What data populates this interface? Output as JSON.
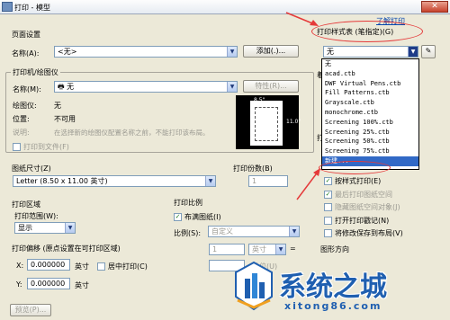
{
  "window": {
    "title": "打印 - 模型",
    "close": "✕"
  },
  "page_setup": {
    "group_label": "页面设置",
    "name_label": "名称(A):",
    "name_value": "<无>",
    "add_button": "添加(.)..."
  },
  "printer": {
    "group_label": "打印机/绘图仪",
    "name_label": "名称(M):",
    "name_value": "无",
    "properties_button": "特性(R)...",
    "plotter_label": "绘图仪:",
    "plotter_value": "无",
    "location_label": "位置:",
    "location_value": "不可用",
    "description_label": "说明:",
    "description_value": "在选择新的绘图仪配置名称之前，不能打印该布局。",
    "print_to_file": "打印到文件(F)",
    "preview_width": "8.5\"",
    "preview_height": "11.0\""
  },
  "paper_size": {
    "label": "图纸尺寸(Z)",
    "value": "Letter (8.50 x 11.00 英寸)"
  },
  "copies": {
    "label": "打印份数(B)",
    "value": "1"
  },
  "plot_area": {
    "group_label": "打印区域",
    "range_label": "打印范围(W):",
    "range_value": "显示"
  },
  "plot_scale": {
    "group_label": "打印比例",
    "fit_paper": "布满图纸(I)",
    "scale_label": "比例(S):",
    "scale_value": "自定义",
    "value1": "1",
    "unit": "英寸",
    "equals": "=",
    "value2": "",
    "units_label": "单位(U)"
  },
  "plot_offset": {
    "group_label": "打印偏移 (原点设置在可打印区域)",
    "x_label": "X:",
    "x_value": "0.000000",
    "x_unit": "英寸",
    "y_label": "Y:",
    "y_value": "0.000000",
    "y_unit": "英寸",
    "center": "居中打印(C)"
  },
  "preview_button": "预览(P)...",
  "help_link": "了解打印",
  "style_table": {
    "label": "打印样式表 (笔指定)(G)",
    "value": "无",
    "items": [
      "无",
      "acad.ctb",
      "DWF Virtual Pens.ctb",
      "Fill Patterns.ctb",
      "Grayscale.ctb",
      "monochrome.ctb",
      "Screening 100%.ctb",
      "Screening 25%.ctb",
      "Screening 50%.ctb",
      "Screening 75%.ctb",
      "新建..."
    ],
    "selected_index": 10
  },
  "right_options": {
    "partial_labels": [
      "着",
      "打"
    ],
    "items": [
      {
        "label": "按样式打印(E)",
        "checked": true,
        "disabled": false
      },
      {
        "label": "最后打印图纸空间",
        "checked": true,
        "disabled": true
      },
      {
        "label": "隐藏图纸空间对象(J)",
        "checked": false,
        "disabled": true
      },
      {
        "label": "打开打印戳记(N)",
        "checked": false,
        "disabled": false
      },
      {
        "label": "将修改保存到布局(V)",
        "checked": false,
        "disabled": false
      }
    ],
    "orientation_label": "图形方向"
  },
  "watermark": {
    "title": "系统之城",
    "url": "xitong86.com"
  },
  "colors": {
    "annotation": "#e53a3a",
    "highlight": "#3169c6",
    "brand_blue": "#1f5fb0"
  }
}
